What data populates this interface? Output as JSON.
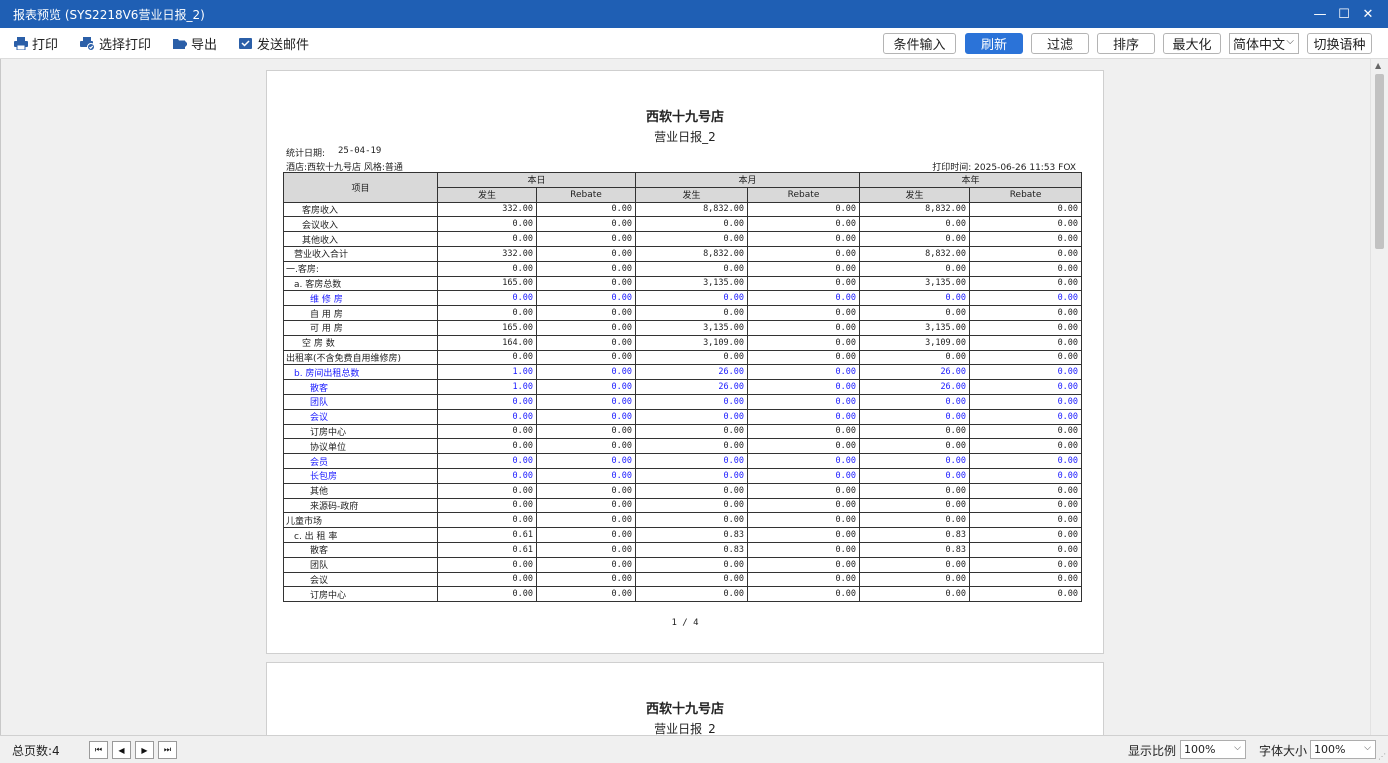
{
  "window": {
    "title": "报表预览 (SYS2218V6营业日报_2)",
    "controls": {
      "minimize": "—",
      "maximize": "☐",
      "close": "✕"
    }
  },
  "toolbar": {
    "print": "打印",
    "select_print": "选择打印",
    "export": "导出",
    "send_mail": "发送邮件",
    "condition_input": "条件输入",
    "refresh": "刷新",
    "filter": "过滤",
    "sort": "排序",
    "maximize": "最大化",
    "language": "简体中文",
    "switch_language": "切换语种",
    "accent_color": "#2b73d8"
  },
  "report": {
    "hotel": "西软十九号店",
    "report_name": "营业日报_2",
    "stat_date_label": "统计日期:",
    "stat_date": "25-04-19",
    "hotel_style": "酒店:西软十九号店 风格:普通",
    "print_time": "打印时间: 2025-06-26 11:53 FOX",
    "page_indicator": "1 / 4",
    "headers": {
      "item": "项目",
      "today": "本日",
      "month": "本月",
      "year": "本年",
      "occur": "发生",
      "rebate": "Rebate"
    },
    "rows": [
      {
        "label": "客房收入",
        "indent": 2,
        "blue": false,
        "vals": [
          "332.00",
          "0.00",
          "8,832.00",
          "0.00",
          "8,832.00",
          "0.00"
        ]
      },
      {
        "label": "会议收入",
        "indent": 2,
        "blue": false,
        "vals": [
          "0.00",
          "0.00",
          "0.00",
          "0.00",
          "0.00",
          "0.00"
        ]
      },
      {
        "label": "其他收入",
        "indent": 2,
        "blue": false,
        "vals": [
          "0.00",
          "0.00",
          "0.00",
          "0.00",
          "0.00",
          "0.00"
        ]
      },
      {
        "label": "营业收入合计",
        "indent": 1,
        "blue": false,
        "vals": [
          "332.00",
          "0.00",
          "8,832.00",
          "0.00",
          "8,832.00",
          "0.00"
        ]
      },
      {
        "label": "一.客房:",
        "indent": 0,
        "blue": false,
        "vals": [
          "0.00",
          "0.00",
          "0.00",
          "0.00",
          "0.00",
          "0.00"
        ]
      },
      {
        "label": "a. 客房总数",
        "indent": 1,
        "blue": false,
        "vals": [
          "165.00",
          "0.00",
          "3,135.00",
          "0.00",
          "3,135.00",
          "0.00"
        ]
      },
      {
        "label": "维 修 房",
        "indent": 3,
        "blue": true,
        "vals": [
          "0.00",
          "0.00",
          "0.00",
          "0.00",
          "0.00",
          "0.00"
        ]
      },
      {
        "label": "自 用 房",
        "indent": 3,
        "blue": false,
        "vals": [
          "0.00",
          "0.00",
          "0.00",
          "0.00",
          "0.00",
          "0.00"
        ]
      },
      {
        "label": "可 用 房",
        "indent": 3,
        "blue": false,
        "vals": [
          "165.00",
          "0.00",
          "3,135.00",
          "0.00",
          "3,135.00",
          "0.00"
        ]
      },
      {
        "label": "空 房 数",
        "indent": 2,
        "blue": false,
        "vals": [
          "164.00",
          "0.00",
          "3,109.00",
          "0.00",
          "3,109.00",
          "0.00"
        ]
      },
      {
        "label": "出租率(不含免费自用维修房)",
        "indent": 0,
        "blue": false,
        "vals": [
          "0.00",
          "0.00",
          "0.00",
          "0.00",
          "0.00",
          "0.00"
        ]
      },
      {
        "label": "b. 房间出租总数",
        "indent": 1,
        "blue": true,
        "vals": [
          "1.00",
          "0.00",
          "26.00",
          "0.00",
          "26.00",
          "0.00"
        ]
      },
      {
        "label": "散客",
        "indent": 3,
        "blue": true,
        "vals": [
          "1.00",
          "0.00",
          "26.00",
          "0.00",
          "26.00",
          "0.00"
        ]
      },
      {
        "label": "团队",
        "indent": 3,
        "blue": true,
        "vals": [
          "0.00",
          "0.00",
          "0.00",
          "0.00",
          "0.00",
          "0.00"
        ]
      },
      {
        "label": "会议",
        "indent": 3,
        "blue": true,
        "vals": [
          "0.00",
          "0.00",
          "0.00",
          "0.00",
          "0.00",
          "0.00"
        ]
      },
      {
        "label": "订房中心",
        "indent": 3,
        "blue": false,
        "vals": [
          "0.00",
          "0.00",
          "0.00",
          "0.00",
          "0.00",
          "0.00"
        ]
      },
      {
        "label": "协议单位",
        "indent": 3,
        "blue": false,
        "vals": [
          "0.00",
          "0.00",
          "0.00",
          "0.00",
          "0.00",
          "0.00"
        ]
      },
      {
        "label": "会员",
        "indent": 3,
        "blue": true,
        "vals": [
          "0.00",
          "0.00",
          "0.00",
          "0.00",
          "0.00",
          "0.00"
        ]
      },
      {
        "label": "长包房",
        "indent": 3,
        "blue": true,
        "vals": [
          "0.00",
          "0.00",
          "0.00",
          "0.00",
          "0.00",
          "0.00"
        ]
      },
      {
        "label": "其他",
        "indent": 3,
        "blue": false,
        "vals": [
          "0.00",
          "0.00",
          "0.00",
          "0.00",
          "0.00",
          "0.00"
        ]
      },
      {
        "label": "来源码-政府",
        "indent": 3,
        "blue": false,
        "vals": [
          "0.00",
          "0.00",
          "0.00",
          "0.00",
          "0.00",
          "0.00"
        ]
      },
      {
        "label": "儿童市场",
        "indent": 0,
        "blue": false,
        "vals": [
          "0.00",
          "0.00",
          "0.00",
          "0.00",
          "0.00",
          "0.00"
        ]
      },
      {
        "label": "c. 出 租 率",
        "indent": 1,
        "blue": false,
        "vals": [
          "0.61",
          "0.00",
          "0.83",
          "0.00",
          "0.83",
          "0.00"
        ]
      },
      {
        "label": "散客",
        "indent": 3,
        "blue": false,
        "vals": [
          "0.61",
          "0.00",
          "0.83",
          "0.00",
          "0.83",
          "0.00"
        ]
      },
      {
        "label": "团队",
        "indent": 3,
        "blue": false,
        "vals": [
          "0.00",
          "0.00",
          "0.00",
          "0.00",
          "0.00",
          "0.00"
        ]
      },
      {
        "label": "会议",
        "indent": 3,
        "blue": false,
        "vals": [
          "0.00",
          "0.00",
          "0.00",
          "0.00",
          "0.00",
          "0.00"
        ]
      },
      {
        "label": "订房中心",
        "indent": 3,
        "blue": false,
        "vals": [
          "0.00",
          "0.00",
          "0.00",
          "0.00",
          "0.00",
          "0.00"
        ]
      }
    ]
  },
  "page2": {
    "hotel": "西软十九号店",
    "report_name": "营业日报_2"
  },
  "statusbar": {
    "total_pages": "总页数:4",
    "first_page": "⏮",
    "prev_page": "◀",
    "next_page": "▶",
    "last_page": "⏭",
    "zoom_label": "显示比例",
    "zoom_value": "100%",
    "font_size_label": "字体大小",
    "font_size_value": "100%"
  }
}
